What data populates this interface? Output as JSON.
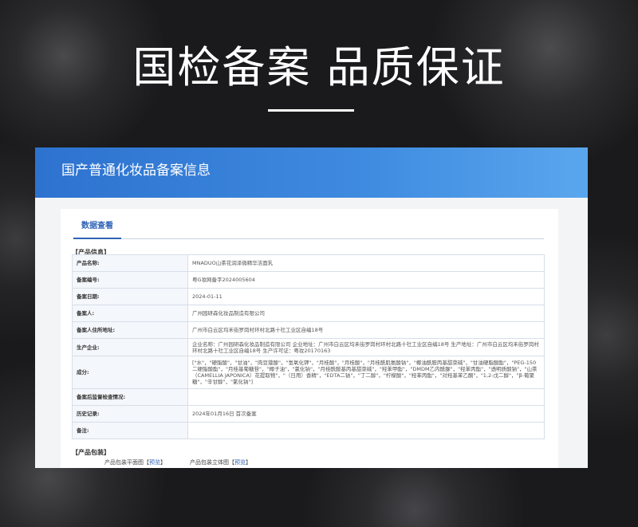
{
  "banner": {
    "title": "国检备案 品质保证"
  },
  "panel": {
    "title": "国产普通化妆品备案信息"
  },
  "tabs": [
    {
      "label": "数据查看"
    }
  ],
  "product_section": {
    "title": "【产品信息】",
    "rows": [
      {
        "label": "产品名称:",
        "value": "MNADUO山茶花润泽微精华洁面乳"
      },
      {
        "label": "备案编号:",
        "value": "粤G妆网备字2024005604"
      },
      {
        "label": "备案日期:",
        "value": "2024-01-11"
      },
      {
        "label": "备案人:",
        "value": "广州园研森化妆品制造有限公司"
      },
      {
        "label": "备案人住所地址:",
        "value": "广州市白云区均禾街罗岗村环村北路十社工业区自编18号"
      },
      {
        "label": "生产企业:",
        "value": "企业名称：广州园研森化妆品制造有限公司 企业地址：广州市白云区均禾街罗岗村环村北路十社工业区自编18号 生产地址：广州市白云区均禾街罗岗村环村北路十社工业区自编18号 生产许可证：粤妆20170163"
      },
      {
        "label": "成分:",
        "value": "[\"水\"，\"硬脂酸\"，\"甘油\"，\"肉豆蔻酸\"，\"氢氧化钾\"，\"月桂酸\"，\"月桂酸\"，\"月桂酰肌氨酸钠\"，\"椰油酰胺丙基甜菜碱\"，\"甘油硬脂酸酯\"，\"PEG-150二硬脂酸酯\"，\"月桂基葡糖苷\"，\"椰子油\"，\"氯化钠\"，\"月桂酰胺基丙基甜菜碱\"，\"羟苯甲酯\"，\"DMDM乙内酰脲\"，\"羟苯丙酯\"，\"透明质酸钠\"，\"山茶（CAMELLIA JAPONICA）花提取物\"，\"（日用）香精\"，\"EDTA二钠\"，\"丁二醇\"，\"柠檬酸\"，\"羟苯丙酯\"，\"对羟基苯乙酮\"，\"1,2-戊二醇\"，\"β-葡聚糖\"，\"辛甘醇\"，\"氯化钠\"]"
      },
      {
        "label": "备案后监督检查情况:",
        "value": ""
      },
      {
        "label": "历史记录:",
        "value": "2024年01月16日 首次备案"
      },
      {
        "label": "备注:",
        "value": ""
      }
    ]
  },
  "package_section": {
    "title": "【产品包装】",
    "items": [
      {
        "label": "产品包装平面图",
        "link": "预览"
      },
      {
        "label": "产品包装立体图",
        "link": "预览"
      }
    ]
  }
}
